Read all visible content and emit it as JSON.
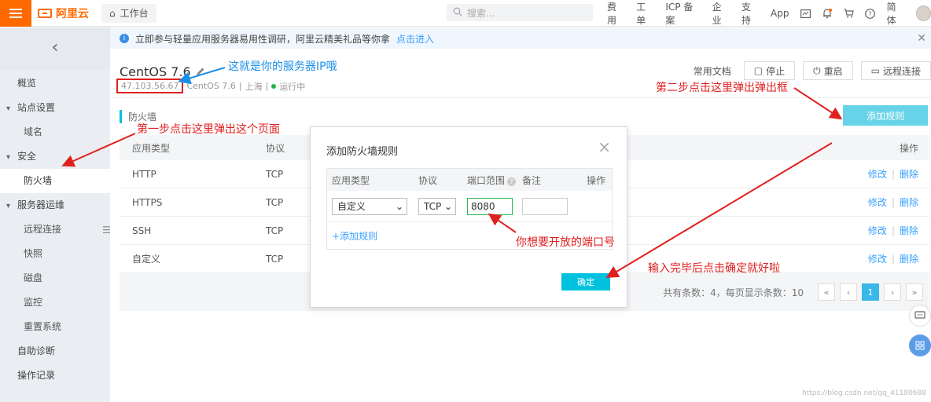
{
  "header": {
    "logo_text": "阿里云",
    "workbench_label": "工作台",
    "search_placeholder": "搜索...",
    "nav": [
      "费用",
      "工单",
      "ICP 备案",
      "企业",
      "支持",
      "App"
    ],
    "lang_label": "简体"
  },
  "sidebar": {
    "items": [
      {
        "label": "概览",
        "kind": "item"
      },
      {
        "label": "站点设置",
        "kind": "group"
      },
      {
        "label": "域名",
        "kind": "sub"
      },
      {
        "label": "安全",
        "kind": "group"
      },
      {
        "label": "防火墙",
        "kind": "sub",
        "active": true
      },
      {
        "label": "服务器运维",
        "kind": "group"
      },
      {
        "label": "远程连接",
        "kind": "sub"
      },
      {
        "label": "快照",
        "kind": "sub"
      },
      {
        "label": "磁盘",
        "kind": "sub"
      },
      {
        "label": "监控",
        "kind": "sub"
      },
      {
        "label": "重置系统",
        "kind": "sub"
      },
      {
        "label": "自助诊断",
        "kind": "item"
      },
      {
        "label": "操作记录",
        "kind": "item"
      }
    ]
  },
  "notice": {
    "text": "立即参与轻量应用服务器易用性调研，阿里云精美礼品等你拿",
    "link": "点击进入"
  },
  "server": {
    "title": "CentOS 7.6",
    "ip": "47.103.56.67",
    "os": "CentOS 7.6",
    "region": "上海",
    "status": "运行中"
  },
  "actions": {
    "docs": "常用文档",
    "stop": "停止",
    "restart": "重启",
    "remote": "远程连接"
  },
  "firewall": {
    "section_label": "防火墙",
    "add_rule": "添加规则",
    "columns": {
      "app_type": "应用类型",
      "protocol": "协议",
      "op": "操作"
    },
    "rows": [
      {
        "app_type": "HTTP",
        "protocol": "TCP"
      },
      {
        "app_type": "HTTPS",
        "protocol": "TCP"
      },
      {
        "app_type": "SSH",
        "protocol": "TCP"
      },
      {
        "app_type": "自定义",
        "protocol": "TCP"
      }
    ],
    "edit": "修改",
    "delete": "删除",
    "footer": "共有条数：4，每页显示条数：10",
    "pager": [
      "«",
      "‹",
      "1",
      "›",
      "»"
    ]
  },
  "modal": {
    "title": "添加防火墙规则",
    "columns": {
      "app_type": "应用类型",
      "protocol": "协议",
      "port": "端口范围",
      "note": "备注",
      "op": "操作"
    },
    "row": {
      "app_type": "自定义",
      "protocol": "TCP",
      "port": "8080",
      "note": ""
    },
    "add_rule": "+添加规则",
    "confirm": "确定"
  },
  "annotations": {
    "ip_hint": "这就是你的服务器IP哦",
    "step1": "第一步点击这里弹出这个页面",
    "step2": "第二步点击这里弹出弹出框",
    "port_hint": "你想要开放的端口号",
    "confirm_hint": "输入完毕后点击确定就好啦"
  },
  "watermark": "https://blog.csdn.net/qq_41180688",
  "colors": {
    "brand": "#ff6a00",
    "accent": "#00c1de",
    "link": "#39a0ff",
    "annotation_red": "#e02020",
    "annotation_blue": "#1a8fe8"
  }
}
